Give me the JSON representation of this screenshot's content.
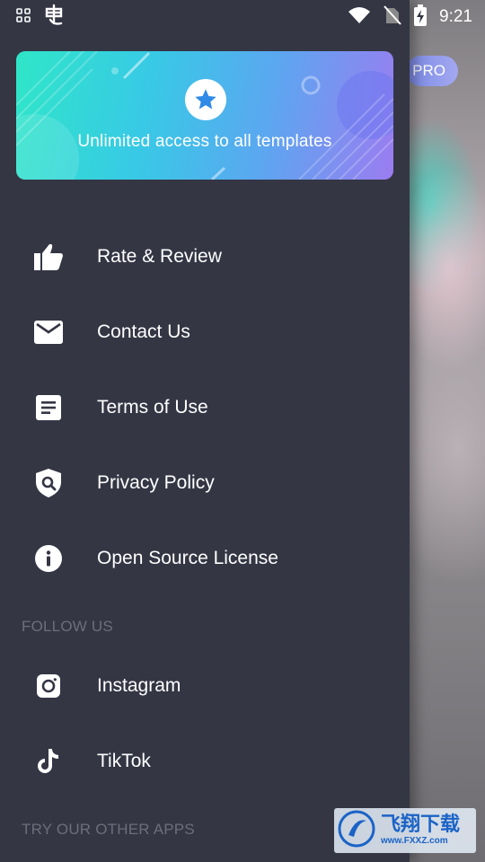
{
  "status_bar": {
    "time": "9:21",
    "left_icons": [
      "apps-grid-icon",
      "app-notification-icon"
    ],
    "right_icons": [
      "wifi-icon",
      "no-sim-icon",
      "battery-charging-icon"
    ]
  },
  "background_app": {
    "pro_badge": "PRO"
  },
  "drawer": {
    "promo": {
      "text": "Unlimited access to all templates",
      "icon": "star-icon"
    },
    "menu": [
      {
        "label": "Rate & Review",
        "icon": "thumbs-up-icon"
      },
      {
        "label": "Contact Us",
        "icon": "mail-icon"
      },
      {
        "label": "Terms of Use",
        "icon": "document-icon"
      },
      {
        "label": "Privacy Policy",
        "icon": "shield-search-icon"
      },
      {
        "label": "Open Source License",
        "icon": "info-icon"
      }
    ],
    "follow_header": "FOLLOW US",
    "social": [
      {
        "label": "Instagram",
        "icon": "instagram-icon"
      },
      {
        "label": "TikTok",
        "icon": "tiktok-icon"
      }
    ],
    "other_apps_header": "TRY OUR OTHER APPS"
  },
  "watermark": {
    "brand": "飞翔下载",
    "url": "www.FXXZ.com"
  },
  "colors": {
    "drawer_bg": "#343644",
    "section_header": "#6c6e7a",
    "promo_gradient_start": "#2fe6c8",
    "promo_gradient_end": "#9b7cf0",
    "star": "#2f8be6"
  }
}
